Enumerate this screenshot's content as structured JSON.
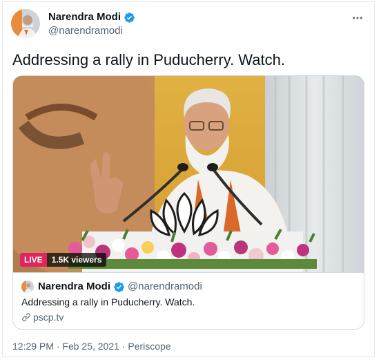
{
  "tweet": {
    "author": {
      "display_name": "Narendra Modi",
      "handle": "@narendramodi",
      "verified": true,
      "avatar_icon": "user-avatar"
    },
    "more_icon": "more-horizontal-icon",
    "text": "Addressing a rally in Puducherry. Watch.",
    "card": {
      "live_label": "LIVE",
      "viewers_label": "1.5K viewers",
      "author_name": "Narendra Modi",
      "author_handle": "@narendramodi",
      "description": "Addressing a rally in Puducherry. Watch.",
      "link_text": "pscp.tv",
      "link_icon": "link-icon"
    },
    "time": "12:29 PM",
    "separator": " · ",
    "date": "Feb 25, 2021",
    "source": "Periscope"
  },
  "colors": {
    "verified_blue": "#1d9bf0",
    "live_red": "#e0245e",
    "secondary_text": "#536471",
    "border": "#cfd9de"
  }
}
